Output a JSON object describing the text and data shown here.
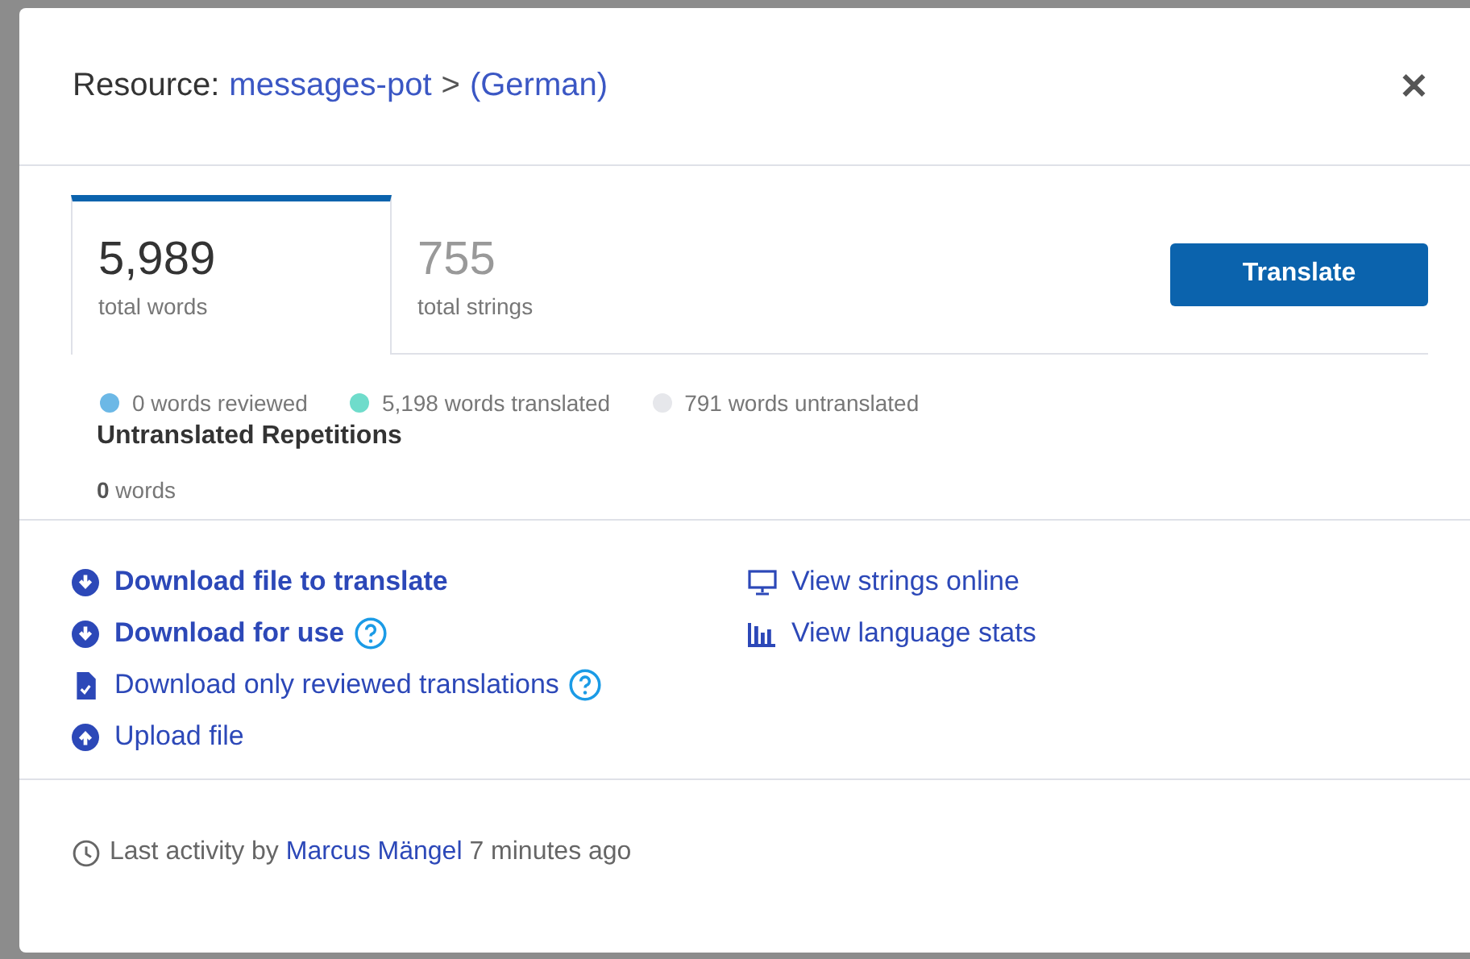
{
  "header": {
    "label": "Resource:",
    "resource": "messages-pot",
    "separator": ">",
    "language": "(German)",
    "close": "✕"
  },
  "tabs": [
    {
      "value": "5,989",
      "caption": "total words",
      "selected": true
    },
    {
      "value": "755",
      "caption": "total strings",
      "selected": false
    }
  ],
  "translate_button": "Translate",
  "legend": [
    {
      "label": "0 words reviewed",
      "color": "#6cb8e6"
    },
    {
      "label": "5,198 words translated",
      "color": "#6fdccb"
    },
    {
      "label": "791 words untranslated",
      "color": "#e6e7eb"
    }
  ],
  "repetitions": {
    "title": "Untranslated Repetitions",
    "count": "0",
    "unit": "words"
  },
  "actions_left": [
    {
      "label": "Download file to translate",
      "kind": "download",
      "bold": true,
      "help": false
    },
    {
      "label": "Download for use",
      "kind": "download",
      "bold": true,
      "help": true
    },
    {
      "label": "Download only reviewed translations",
      "kind": "file-check",
      "bold": false,
      "help": true
    },
    {
      "label": "Upload file",
      "kind": "upload",
      "bold": false,
      "help": false
    }
  ],
  "actions_right": [
    {
      "label": "View strings online",
      "kind": "monitor"
    },
    {
      "label": "View language stats",
      "kind": "chart"
    }
  ],
  "footer": {
    "prefix": "Last activity by",
    "user": "Marcus Mängel",
    "suffix": "7 minutes ago"
  }
}
